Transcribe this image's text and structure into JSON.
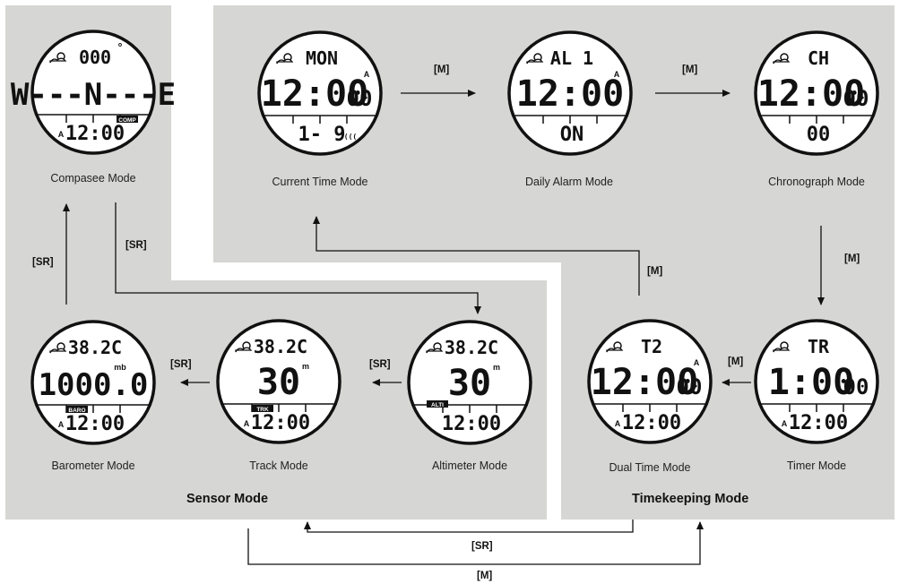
{
  "groups": {
    "sensor": "Sensor Mode",
    "timekeeping": "Timekeeping Mode"
  },
  "modes": [
    {
      "id": "compass",
      "caption": "Compasee Mode",
      "top": "000",
      "top_icon": "weather",
      "main": "W---N---E",
      "tag": "COMP",
      "bottom": "12:00",
      "bottom_prefix": "A",
      "degree": "°"
    },
    {
      "id": "current",
      "caption": "Current Time Mode",
      "top": "MON",
      "top_icon": "weather",
      "main": "12:00",
      "main_small": "00",
      "corner": "A",
      "bottom": "1- 9",
      "bottom_extra": "((("
    },
    {
      "id": "alarm",
      "caption": "Daily Alarm Mode",
      "top": "AL 1",
      "top_icon": "weather",
      "main": "12:00",
      "corner": "A",
      "bottom": "ON"
    },
    {
      "id": "chrono",
      "caption": "Chronograph Mode",
      "top": "CH",
      "top_icon": "weather",
      "main": "12:00",
      "main_small": "00",
      "bottom": "00"
    },
    {
      "id": "baro",
      "caption": "Barometer Mode",
      "top": "38.2C",
      "top_icon": "weather",
      "main": "1000.0",
      "unit": "mb",
      "tag": "BARO",
      "bottom": "12:00",
      "bottom_prefix": "A"
    },
    {
      "id": "track",
      "caption": "Track Mode",
      "top": "38.2C",
      "top_icon": "weather",
      "main": "30",
      "unit": "m",
      "tag": "TRK",
      "bottom": "12:00",
      "bottom_prefix": "A"
    },
    {
      "id": "alti",
      "caption": "Altimeter Mode",
      "top": "38.2C",
      "top_icon": "weather",
      "main": "30",
      "unit": "m",
      "tag": "ALTI",
      "bottom": "12:00"
    },
    {
      "id": "dual",
      "caption": "Dual Time Mode",
      "top": "T2",
      "top_icon": "weather",
      "main": "12:00",
      "main_small": "00",
      "corner": "A",
      "bottom": "12:00",
      "bottom_prefix": "A"
    },
    {
      "id": "timer",
      "caption": "Timer Mode",
      "top": "TR",
      "top_icon": "weather",
      "main": "1:00",
      "main_small": "00",
      "bottom": "12:00",
      "bottom_prefix": "A"
    }
  ],
  "keys": {
    "m_current_alarm": "[M]",
    "m_alarm_chrono": "[M]",
    "m_chrono_timer": "[M]",
    "m_timer_dual": "[M]",
    "m_dual_current": "[M]",
    "sr_alti_track": "[SR]",
    "sr_track_baro": "[SR]",
    "sr_baro_compass": "[SR]",
    "sr_compass_alti": "[SR]",
    "sr_timekeeping_sensor": "[SR]",
    "m_sensor_timekeeping": "[M]"
  }
}
